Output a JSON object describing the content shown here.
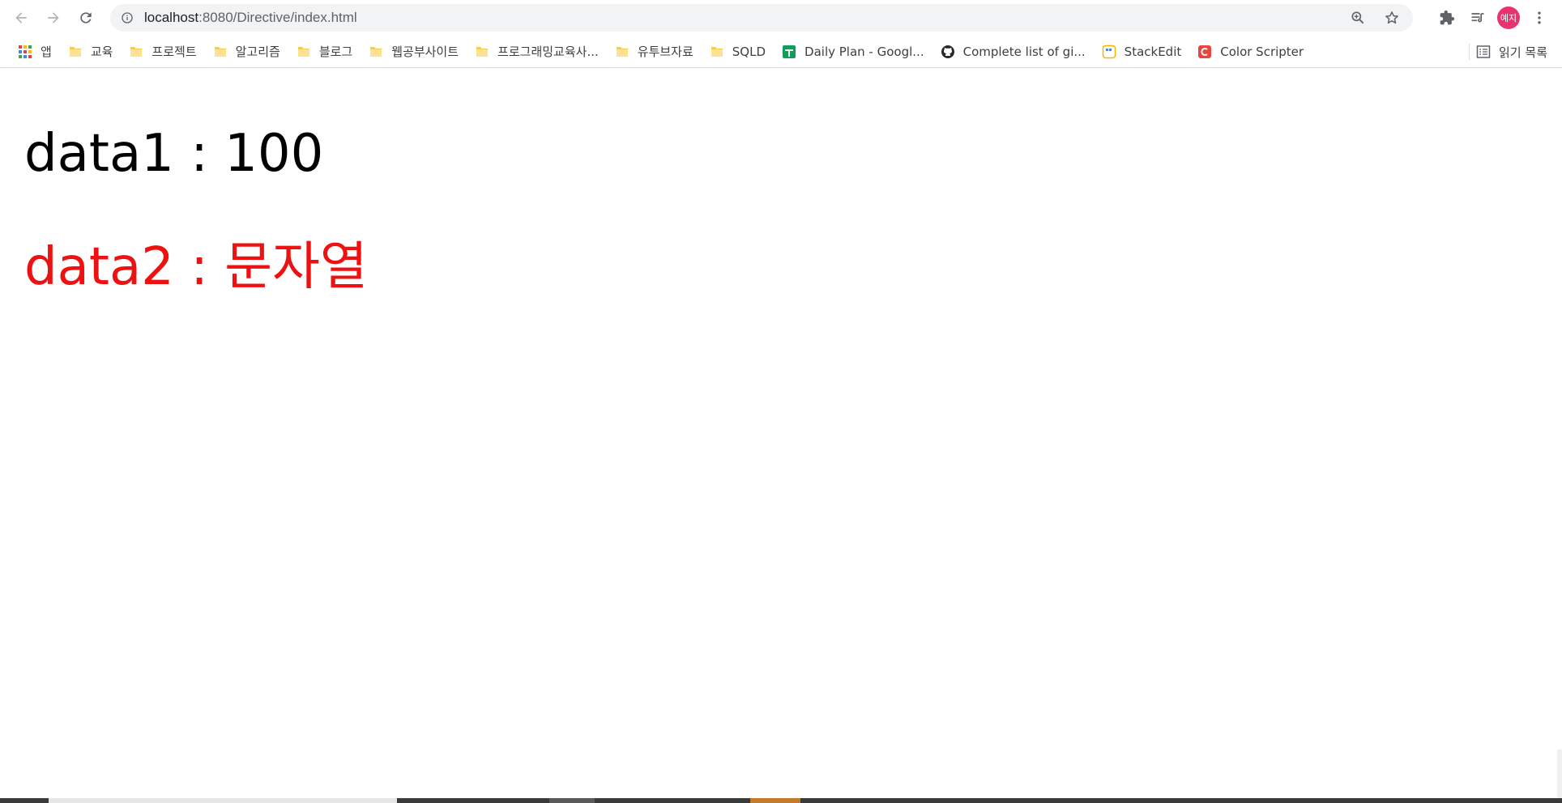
{
  "browser": {
    "url_host": "localhost",
    "url_path": ":8080/Directive/index.html",
    "profile_label": "예지",
    "profile_color": "#e8336e"
  },
  "bookmarks": [
    {
      "label": "앱",
      "icon": "apps-grid-icon"
    },
    {
      "label": "교육",
      "icon": "folder-icon"
    },
    {
      "label": "프로젝트",
      "icon": "folder-icon"
    },
    {
      "label": "알고리즘",
      "icon": "folder-icon"
    },
    {
      "label": "블로그",
      "icon": "folder-icon"
    },
    {
      "label": "웹공부사이트",
      "icon": "folder-icon"
    },
    {
      "label": "프로그래밍교육사...",
      "icon": "folder-icon"
    },
    {
      "label": "유투브자료",
      "icon": "folder-icon"
    },
    {
      "label": "SQLD",
      "icon": "folder-icon"
    },
    {
      "label": "Daily Plan - Googl...",
      "icon": "google-sheets-icon"
    },
    {
      "label": "Complete list of gi...",
      "icon": "github-icon"
    },
    {
      "label": "StackEdit",
      "icon": "stackedit-icon"
    },
    {
      "label": "Color Scripter",
      "icon": "color-scripter-icon"
    }
  ],
  "reading_list_label": "읽기 목록",
  "content": {
    "line1": "data1 : 100",
    "line2": "data2 : 문자열",
    "line2_color": "#ee1111"
  }
}
